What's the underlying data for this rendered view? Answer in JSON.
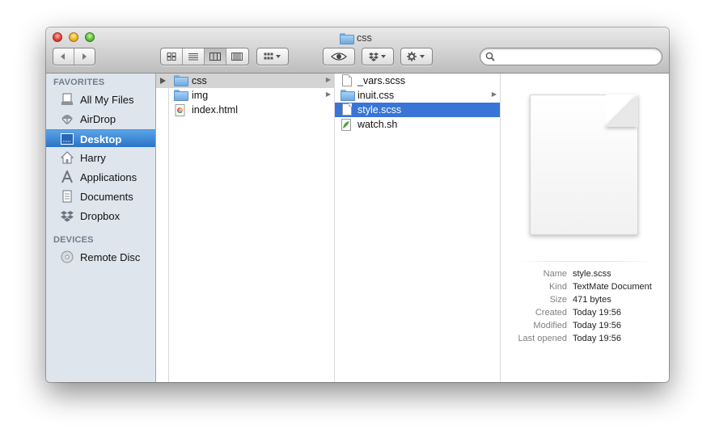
{
  "window": {
    "title": "css"
  },
  "sidebar": {
    "favorites_heading": "FAVORITES",
    "favorites": [
      {
        "label": "All My Files",
        "icon": "all-my-files-icon"
      },
      {
        "label": "AirDrop",
        "icon": "airdrop-icon"
      },
      {
        "label": "Desktop",
        "icon": "desktop-icon",
        "selected": true
      },
      {
        "label": "Harry",
        "icon": "home-icon"
      },
      {
        "label": "Applications",
        "icon": "applications-icon"
      },
      {
        "label": "Documents",
        "icon": "documents-icon"
      },
      {
        "label": "Dropbox",
        "icon": "dropbox-icon"
      }
    ],
    "devices_heading": "DEVICES",
    "devices": [
      {
        "label": "Remote Disc",
        "icon": "disc-icon"
      }
    ]
  },
  "columns": {
    "col1": [
      {
        "name": "css",
        "type": "folder",
        "has_children": true,
        "highlighted": true
      },
      {
        "name": "img",
        "type": "folder",
        "has_children": true
      },
      {
        "name": "index.html",
        "type": "html"
      }
    ],
    "col2": [
      {
        "name": "_vars.scss",
        "type": "document"
      },
      {
        "name": "inuit.css",
        "type": "folder",
        "has_children": true
      },
      {
        "name": "style.scss",
        "type": "document",
        "selected": true
      },
      {
        "name": "watch.sh",
        "type": "script"
      }
    ]
  },
  "preview": {
    "name_label": "Name",
    "name": "style.scss",
    "kind_label": "Kind",
    "kind": "TextMate Document",
    "size_label": "Size",
    "size": "471 bytes",
    "created_label": "Created",
    "created": "Today 19:56",
    "modified_label": "Modified",
    "modified": "Today 19:56",
    "last_opened_label": "Last opened",
    "last_opened": "Today 19:56"
  },
  "colors": {
    "selection": "#3875d7",
    "sidebar_selection": "#2a74c8",
    "sidebar_bg": "#dfe5ed"
  }
}
